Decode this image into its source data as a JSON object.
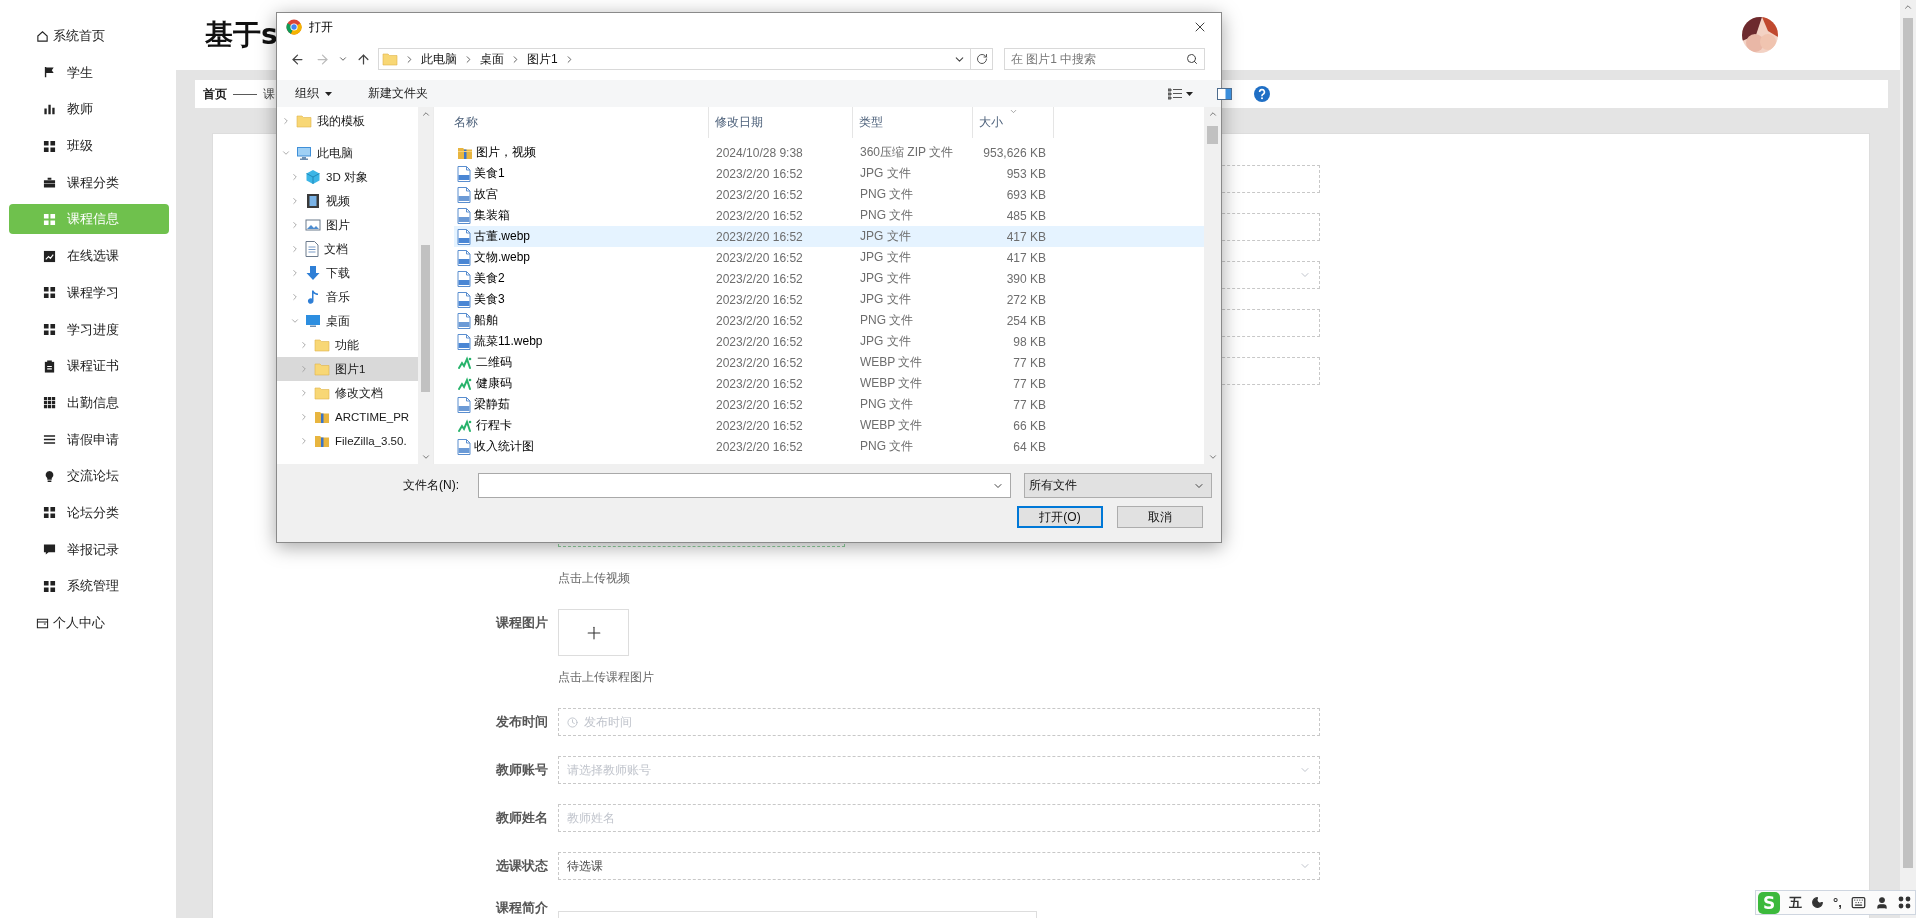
{
  "sidebar": {
    "items": [
      {
        "label": "系统首页",
        "kind": "link",
        "selected": false
      },
      {
        "label": "学生",
        "kind": "menu",
        "selected": false
      },
      {
        "label": "教师",
        "kind": "menu",
        "selected": false
      },
      {
        "label": "班级",
        "kind": "menu",
        "selected": false
      },
      {
        "label": "课程分类",
        "kind": "menu",
        "selected": false
      },
      {
        "label": "课程信息",
        "kind": "menu",
        "selected": true
      },
      {
        "label": "在线选课",
        "kind": "menu",
        "selected": false
      },
      {
        "label": "课程学习",
        "kind": "menu",
        "selected": false
      },
      {
        "label": "学习进度",
        "kind": "menu",
        "selected": false
      },
      {
        "label": "课程证书",
        "kind": "menu",
        "selected": false
      },
      {
        "label": "出勤信息",
        "kind": "menu",
        "selected": false
      },
      {
        "label": "请假申请",
        "kind": "menu",
        "selected": false
      },
      {
        "label": "交流论坛",
        "kind": "menu",
        "selected": false
      },
      {
        "label": "论坛分类",
        "kind": "menu",
        "selected": false
      },
      {
        "label": "举报记录",
        "kind": "menu",
        "selected": false
      },
      {
        "label": "系统管理",
        "kind": "menu",
        "selected": false
      },
      {
        "label": "个人中心",
        "kind": "link",
        "selected": false
      }
    ]
  },
  "header": {
    "title": "基于s"
  },
  "breadcrumb": {
    "home": "首页",
    "separator": "——",
    "current": "课"
  },
  "form": {
    "rows": [
      {
        "kind": "input"
      },
      {
        "kind": "input"
      },
      {
        "kind": "select"
      },
      {
        "kind": "input"
      },
      {
        "kind": "input"
      },
      {
        "kind": "video_upload",
        "hint": "点击上传视频"
      },
      {
        "kind": "image_upload",
        "label": "课程图片",
        "hint": "点击上传课程图片"
      },
      {
        "kind": "date",
        "label": "发布时间",
        "placeholder": "发布时间"
      },
      {
        "kind": "select",
        "label": "教师账号",
        "placeholder": "请选择教师账号"
      },
      {
        "kind": "input",
        "label": "教师姓名",
        "placeholder": "教师姓名"
      },
      {
        "kind": "select",
        "label": "选课状态",
        "value": "待选课"
      },
      {
        "kind": "textarea",
        "label": "课程简介"
      }
    ]
  },
  "dialog": {
    "title": "打开",
    "path": [
      "此电脑",
      "桌面",
      "图片1"
    ],
    "search_placeholder": "在 图片1 中搜索",
    "toolbar": {
      "organize": "组织",
      "new_folder": "新建文件夹"
    },
    "nav": [
      {
        "label": "我的模板",
        "kind": "folder",
        "expanded": false,
        "selected": false
      },
      {
        "label": "此电脑",
        "kind": "computer",
        "expanded": true,
        "selected": false,
        "children": [
          {
            "label": "3D 对象",
            "kind": "cube",
            "expanded": false,
            "selected": false
          },
          {
            "label": "视频",
            "kind": "video",
            "expanded": false,
            "selected": false
          },
          {
            "label": "图片",
            "kind": "pictures",
            "expanded": false,
            "selected": false
          },
          {
            "label": "文档",
            "kind": "documents",
            "expanded": false,
            "selected": false
          },
          {
            "label": "下载",
            "kind": "downloads",
            "expanded": false,
            "selected": false
          },
          {
            "label": "音乐",
            "kind": "music",
            "expanded": false,
            "selected": false
          },
          {
            "label": "桌面",
            "kind": "desktop",
            "expanded": true,
            "selected": false,
            "children": [
              {
                "label": "功能",
                "kind": "folder",
                "expanded": false,
                "selected": false
              },
              {
                "label": "图片1",
                "kind": "folder",
                "expanded": false,
                "selected": true
              },
              {
                "label": "修改文档",
                "kind": "folder",
                "expanded": false,
                "selected": false
              },
              {
                "label": "ARCTIME_PR",
                "kind": "app",
                "expanded": false,
                "selected": false
              },
              {
                "label": "FileZilla_3.50.",
                "kind": "app",
                "expanded": false,
                "selected": false
              }
            ]
          }
        ]
      }
    ],
    "columns": [
      "名称",
      "修改日期",
      "类型",
      "大小"
    ],
    "files": [
      {
        "name": "图片，视频",
        "modified": "2024/10/28 9:38",
        "type": "360压缩 ZIP 文件",
        "size": "953,626 KB",
        "kind": "archive",
        "selected": false
      },
      {
        "name": "美食1",
        "modified": "2023/2/20 16:52",
        "type": "JPG 文件",
        "size": "953 KB",
        "kind": "jpg",
        "selected": false
      },
      {
        "name": "故宫",
        "modified": "2023/2/20 16:52",
        "type": "PNG 文件",
        "size": "693 KB",
        "kind": "png",
        "selected": false
      },
      {
        "name": "集装箱",
        "modified": "2023/2/20 16:52",
        "type": "PNG 文件",
        "size": "485 KB",
        "kind": "png",
        "selected": false
      },
      {
        "name": "古董.webp",
        "modified": "2023/2/20 16:52",
        "type": "JPG 文件",
        "size": "417 KB",
        "kind": "jpg",
        "selected": true
      },
      {
        "name": "文物.webp",
        "modified": "2023/2/20 16:52",
        "type": "JPG 文件",
        "size": "417 KB",
        "kind": "jpg",
        "selected": false
      },
      {
        "name": "美食2",
        "modified": "2023/2/20 16:52",
        "type": "JPG 文件",
        "size": "390 KB",
        "kind": "jpg",
        "selected": false
      },
      {
        "name": "美食3",
        "modified": "2023/2/20 16:52",
        "type": "JPG 文件",
        "size": "272 KB",
        "kind": "jpg",
        "selected": false
      },
      {
        "name": "船舶",
        "modified": "2023/2/20 16:52",
        "type": "PNG 文件",
        "size": "254 KB",
        "kind": "png",
        "selected": false
      },
      {
        "name": "蔬菜11.webp",
        "modified": "2023/2/20 16:52",
        "type": "JPG 文件",
        "size": "98 KB",
        "kind": "jpg",
        "selected": false
      },
      {
        "name": "二维码",
        "modified": "2023/2/20 16:52",
        "type": "WEBP 文件",
        "size": "77 KB",
        "kind": "webp",
        "selected": false
      },
      {
        "name": "健康码",
        "modified": "2023/2/20 16:52",
        "type": "WEBP 文件",
        "size": "77 KB",
        "kind": "webp",
        "selected": false
      },
      {
        "name": "梁静茹",
        "modified": "2023/2/20 16:52",
        "type": "PNG 文件",
        "size": "77 KB",
        "kind": "png",
        "selected": false
      },
      {
        "name": "行程卡",
        "modified": "2023/2/20 16:52",
        "type": "WEBP 文件",
        "size": "66 KB",
        "kind": "webp",
        "selected": false
      },
      {
        "name": "收入统计图",
        "modified": "2023/2/20 16:52",
        "type": "PNG 文件",
        "size": "64 KB",
        "kind": "png",
        "selected": false
      }
    ],
    "filename_label": "文件名(N):",
    "filter": "所有文件",
    "buttons": [
      {
        "label": "打开(O)",
        "kind": "primary"
      },
      {
        "label": "取消",
        "kind": "secondary"
      }
    ]
  },
  "ime": {
    "logo": "S",
    "mode": "五",
    "punct": "°,"
  }
}
